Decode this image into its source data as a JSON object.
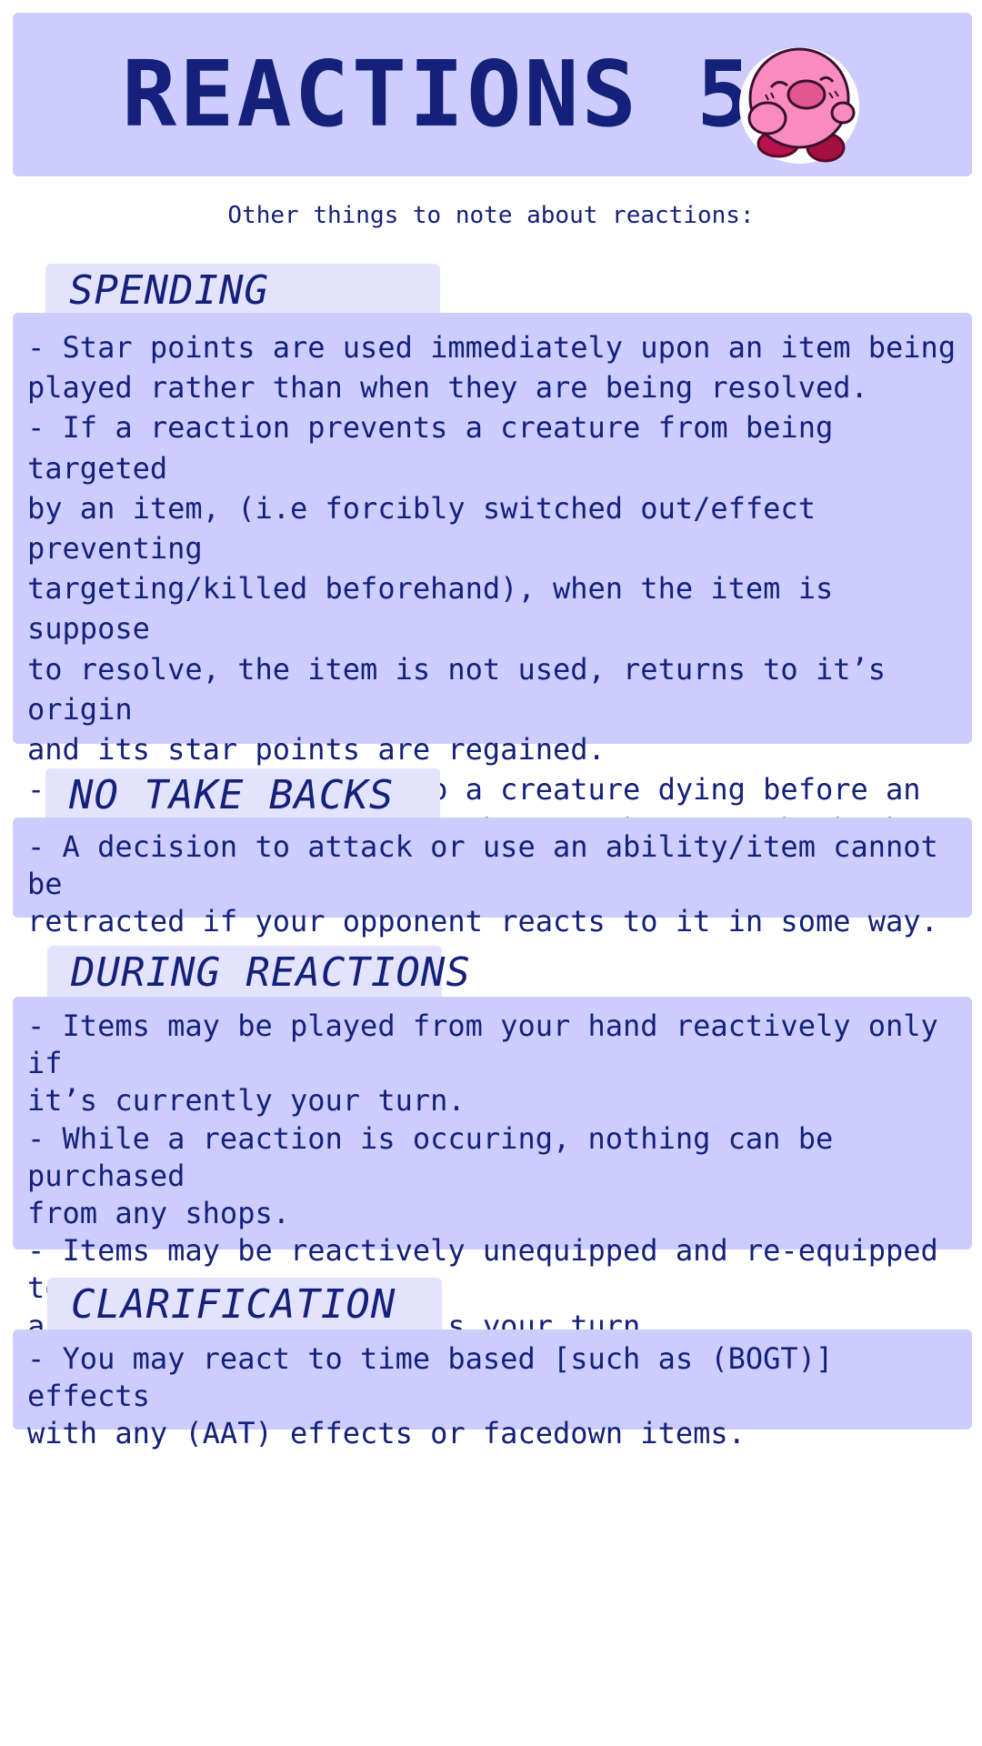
{
  "header": {
    "title": "REACTIONS 5"
  },
  "subtitle": "Other things to note about reactions:",
  "sections": [
    {
      "heading": "SPENDING",
      "body": "- Star points are used immediately upon an item being\nplayed rather than when they are being resolved.\n- If a reaction prevents a creature from being targeted\nby an item, (i.e forcibly switched out/effect preventing\ntargeting/killed beforehand), when the item is suppose\nto resolve, the item is not used, returns to it’s origin\nand its star points are regained.\n- If a reaction leads to a creature dying before an\nattack is resolved, then the attacker gets back the\nresource, whether it’s an item/action/ability."
    },
    {
      "heading": "NO TAKE BACKS",
      "body": "- A decision to attack or use an ability/item cannot be\nretracted if your opponent reacts to it in some way."
    },
    {
      "heading": "DURING REACTIONS",
      "body": "- Items may be played from your hand reactively only if\nit’s currently your turn.\n- While a reaction is occuring, nothing can be purchased\nfrom any shops.\n- Items may be reactively unequipped and re-equipped to\nanother creature if it is your turn."
    },
    {
      "heading": "CLARIFICATION",
      "body": "- You may react to time based [such as (BOGT)] effects\nwith any (AAT) effects or facedown items."
    }
  ],
  "colors": {
    "panel": "#cccdfd",
    "tab": "#e3e3fd",
    "text": "#14207a",
    "mascot_pink": "#f98bbe",
    "mascot_feet": "#b8124a"
  },
  "icons": {
    "mascot": "pink-puffball-mascot-icon"
  }
}
